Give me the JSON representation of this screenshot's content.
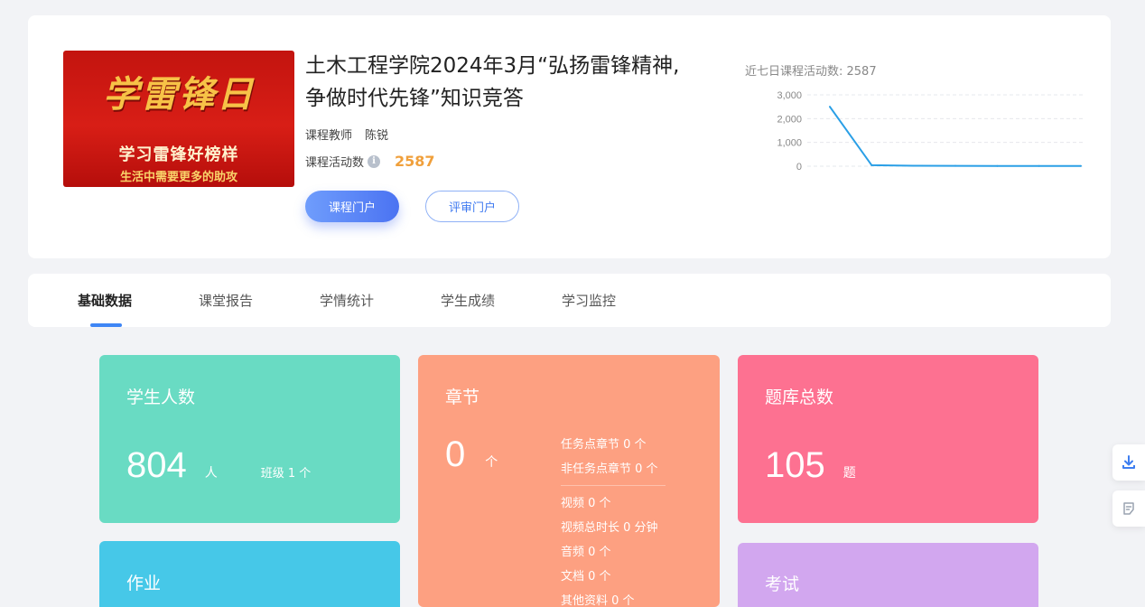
{
  "course": {
    "cover": {
      "big_text": "学雷锋日",
      "sub_line1": "学习雷锋好榜样",
      "sub_line2": "生活中需要更多的助攻",
      "colors": {
        "background": "#d11a14",
        "gold": "#f7c247"
      }
    },
    "title": "土木工程学院2024年3月“弘扬雷锋精神,争做时代先锋”知识竞答",
    "teacher_label": "课程教师",
    "teacher_name": "陈锐",
    "activity_label": "课程活动数",
    "activity_icon": "info-icon",
    "activity_value": "2587",
    "portal_button": "课程门户",
    "review_button": "评审门户"
  },
  "activity_chart_title": "近七日课程活动数: 2587",
  "chart_data": {
    "type": "line",
    "title": "近七日课程活动数: 2587",
    "x": [
      1,
      2,
      3,
      4,
      5,
      6,
      7
    ],
    "values": [
      2500,
      40,
      20,
      15,
      10,
      10,
      10
    ],
    "ylim": [
      0,
      3000
    ],
    "yticks": [
      "0",
      "1,000",
      "2,000",
      "3,000"
    ],
    "grid": true,
    "line_color": "#2a9fe6"
  },
  "tabs": [
    {
      "label": "基础数据",
      "active": true
    },
    {
      "label": "课堂报告",
      "active": false
    },
    {
      "label": "学情统计",
      "active": false
    },
    {
      "label": "学生成绩",
      "active": false
    },
    {
      "label": "学习监控",
      "active": false
    }
  ],
  "stats": {
    "students": {
      "title": "学生人数",
      "value": "804",
      "unit": "人",
      "class_text": "班级 1 个",
      "color": "#69dbc3"
    },
    "chapters": {
      "title": "章节",
      "value": "0",
      "unit": "个",
      "details_a": [
        "任务点章节 0 个",
        "非任务点章节 0 个"
      ],
      "details_b": [
        "视频 0 个",
        "视频总时长 0 分钟",
        "音频 0 个",
        "文档 0 个",
        "其他资料 0 个"
      ],
      "color": "#fda081"
    },
    "question_bank": {
      "title": "题库总数",
      "value": "105",
      "unit": "题",
      "color": "#fd7191"
    },
    "homework": {
      "title": "作业",
      "color": "#46c8e8"
    },
    "exam": {
      "title": "考试",
      "color": "#d2a7ef"
    }
  },
  "float_buttons": {
    "download_icon": "download-icon",
    "notes_icon": "notes-icon"
  }
}
